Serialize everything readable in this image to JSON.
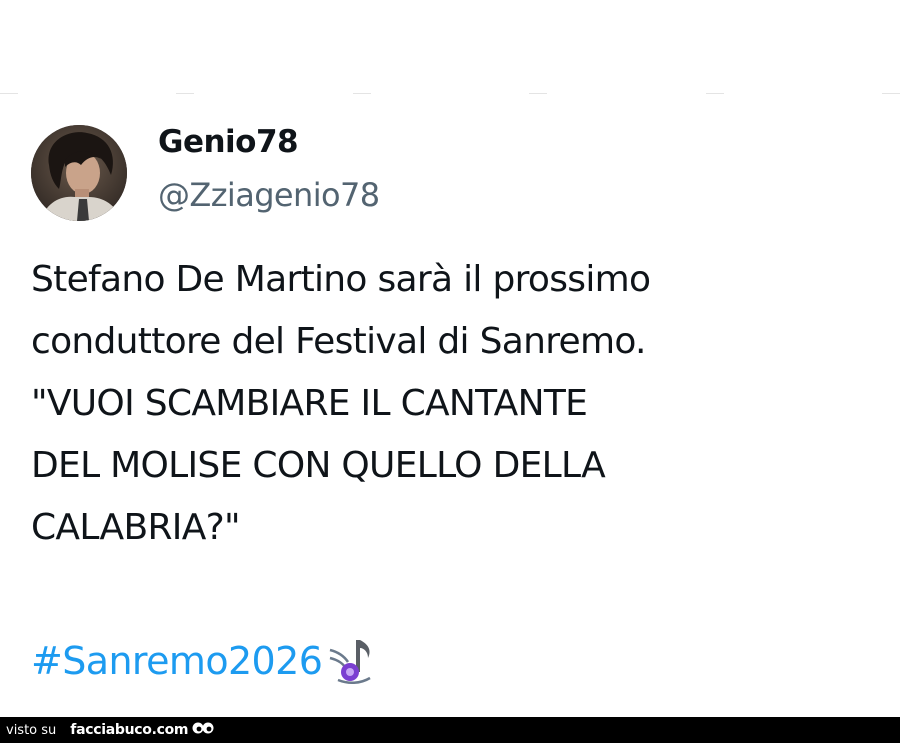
{
  "tweet": {
    "display_name": "Genio78",
    "handle": "@Zziagenio78",
    "text": "Stefano De Martino sarà il prossimo\nconduttore del Festival di Sanremo.\n \"VUOI SCAMBIARE IL CANTANTE\nDEL MOLISE CON QUELLO DELLA\nCALABRIA?\"",
    "hashtag": "#Sanremo2026",
    "hashtag_emoji_icon": "music-notes-icon"
  },
  "footer": {
    "prefix": "visto su",
    "site": "facciabuco.com",
    "logo_icon": "eyes-logo-icon"
  },
  "colors": {
    "text": "#0f1419",
    "handle": "#536471",
    "hashtag": "#1d9bf0",
    "footer_bg": "#000000"
  }
}
